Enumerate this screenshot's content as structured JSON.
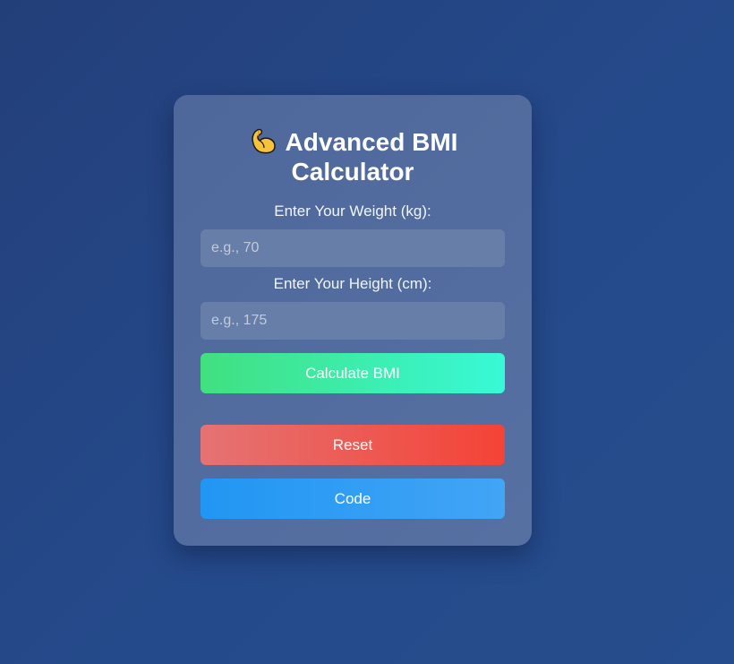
{
  "card": {
    "title_line1": "Advanced BMI",
    "title_line2": "Calculator",
    "title_icon": "flexed-biceps-icon"
  },
  "weight": {
    "label": "Enter Your Weight (kg):",
    "placeholder": "e.g., 70",
    "value": ""
  },
  "height": {
    "label": "Enter Your Height (cm):",
    "placeholder": "e.g., 175",
    "value": ""
  },
  "buttons": {
    "calculate": "Calculate BMI",
    "reset": "Reset",
    "code": "Code"
  },
  "colors": {
    "background": "#244587",
    "card": "#536c9f",
    "calculate_start": "#41e07f",
    "calculate_end": "#38f9d7",
    "reset_start": "#e57373",
    "reset_end": "#f44336",
    "code_start": "#2196f3",
    "code_end": "#42a5f5"
  }
}
